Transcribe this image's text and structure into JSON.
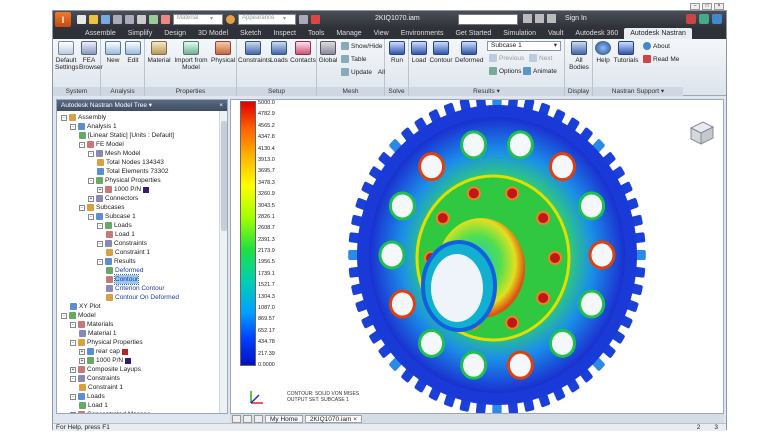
{
  "titlebar": {
    "material_placeholder": "Material",
    "appearance_placeholder": "Appearance",
    "document_title": "2KIQ1070.iam",
    "sign_in": "Sign In"
  },
  "tabs": [
    "Assemble",
    "Simplify",
    "Design",
    "3D Model",
    "Sketch",
    "Inspect",
    "Tools",
    "Manage",
    "View",
    "Environments",
    "Get Started",
    "Simulation",
    "Vault",
    "Autodesk 360",
    "Autodesk Nastran"
  ],
  "active_tab": "Autodesk Nastran",
  "ribbon": {
    "system": {
      "label": "System",
      "default_settings": "Default Settings",
      "fea_browser": "FEA Browser"
    },
    "analysis": {
      "label": "Analysis",
      "new": "New",
      "edit": "Edit"
    },
    "properties": {
      "label": "Properties",
      "material": "Material",
      "import_from_model": "Import from Model",
      "physical": "Physical"
    },
    "setup": {
      "label": "Setup",
      "constraints": "Constraints",
      "loads": "Loads",
      "contacts": "Contacts"
    },
    "mesh": {
      "label": "Mesh",
      "global": "Global",
      "show_hide": "Show/Hide",
      "table": "Table",
      "update": "Update",
      "all": "All"
    },
    "solve": {
      "label": "Solve",
      "run": "Run"
    },
    "results": {
      "label": "Results",
      "load": "Load",
      "contour": "Contour",
      "deformed": "Deformed",
      "subcase": "Subcase 1",
      "previous": "Previous",
      "next": "Next",
      "options": "Options",
      "animate": "Animate"
    },
    "display": {
      "label": "Display",
      "all_bodies": "All Bodies"
    },
    "support": {
      "label": "Nastran Support",
      "help": "Help",
      "tutorials": "Tutorials",
      "about": "About",
      "read_me": "Read Me"
    }
  },
  "tree": {
    "header": "Autodesk Nastran Model Tree",
    "rows": [
      {
        "text": "Assembly",
        "indent": 0,
        "exp": "-"
      },
      {
        "text": "Analysis 1",
        "indent": 1,
        "exp": "-"
      },
      {
        "text": "[Linear Static] [Units : Default]",
        "indent": 2,
        "exp": ""
      },
      {
        "text": "FE Model",
        "indent": 2,
        "exp": "-"
      },
      {
        "text": "Mesh Model",
        "indent": 3,
        "exp": "-"
      },
      {
        "text": "Total Nodes 134343",
        "indent": 4,
        "exp": ""
      },
      {
        "text": "Total Elements 73302",
        "indent": 4,
        "exp": ""
      },
      {
        "text": "Physical Properties",
        "indent": 3,
        "exp": "-"
      },
      {
        "text": "1000 P/N",
        "indent": 4,
        "exp": "+",
        "swatch": "#3a1a70"
      },
      {
        "text": "Connectors",
        "indent": 3,
        "exp": "+"
      },
      {
        "text": "Subcases",
        "indent": 2,
        "exp": "-"
      },
      {
        "text": "Subcase 1",
        "indent": 3,
        "exp": "-"
      },
      {
        "text": "Loads",
        "indent": 4,
        "exp": "-"
      },
      {
        "text": "Load 1",
        "indent": 5,
        "exp": ""
      },
      {
        "text": "Constraints",
        "indent": 4,
        "exp": "-"
      },
      {
        "text": "Constraint 1",
        "indent": 5,
        "exp": ""
      },
      {
        "text": "Results",
        "indent": 4,
        "exp": "-"
      },
      {
        "text": "Deformed",
        "indent": 5,
        "exp": "",
        "blue": true
      },
      {
        "text": "Contour",
        "indent": 5,
        "exp": "",
        "blue": true,
        "selected": true
      },
      {
        "text": "Criterion Contour",
        "indent": 5,
        "exp": "",
        "blue": true
      },
      {
        "text": "Contour On Deformed",
        "indent": 5,
        "exp": "",
        "blue": true
      },
      {
        "text": "XY Plot",
        "indent": 1,
        "exp": ""
      },
      {
        "text": "Model",
        "indent": 0,
        "exp": "-"
      },
      {
        "text": "Materials",
        "indent": 1,
        "exp": "-"
      },
      {
        "text": "Material 1",
        "indent": 2,
        "exp": ""
      },
      {
        "text": "Physical Properties",
        "indent": 1,
        "exp": "-"
      },
      {
        "text": "rear cap",
        "indent": 2,
        "exp": "+",
        "swatch": "#c02020"
      },
      {
        "text": "1000 P/N",
        "indent": 2,
        "exp": "+",
        "swatch": "#3a1a70"
      },
      {
        "text": "Composite Layups",
        "indent": 1,
        "exp": "+"
      },
      {
        "text": "Constraints",
        "indent": 1,
        "exp": "-"
      },
      {
        "text": "Constraint 1",
        "indent": 2,
        "exp": ""
      },
      {
        "text": "Loads",
        "indent": 1,
        "exp": "-"
      },
      {
        "text": "Load 1",
        "indent": 2,
        "exp": ""
      },
      {
        "text": "Concentrated Masses",
        "indent": 1,
        "exp": "+"
      }
    ]
  },
  "legend": {
    "values": [
      "5000.0",
      "4782.9",
      "4565.2",
      "4347.8",
      "4130.4",
      "3913.0",
      "3695.7",
      "3478.3",
      "3260.9",
      "3043.5",
      "2826.1",
      "2608.7",
      "2391.3",
      "2173.9",
      "1956.5",
      "1739.1",
      "1521.7",
      "1304.3",
      "1087.0",
      "869.57",
      "652.17",
      "434.78",
      "217.39",
      "0.0000"
    ]
  },
  "contour_info": {
    "line1": "CONTOUR: SOLID VON MISES",
    "line2": "OUTPUT SET: SUBCASE 1"
  },
  "doctabs": {
    "home": "My Home",
    "file": "2KIQ1070.iam"
  },
  "statusbar": {
    "help": "For Help, press F1",
    "n1": "2",
    "n2": "3"
  }
}
